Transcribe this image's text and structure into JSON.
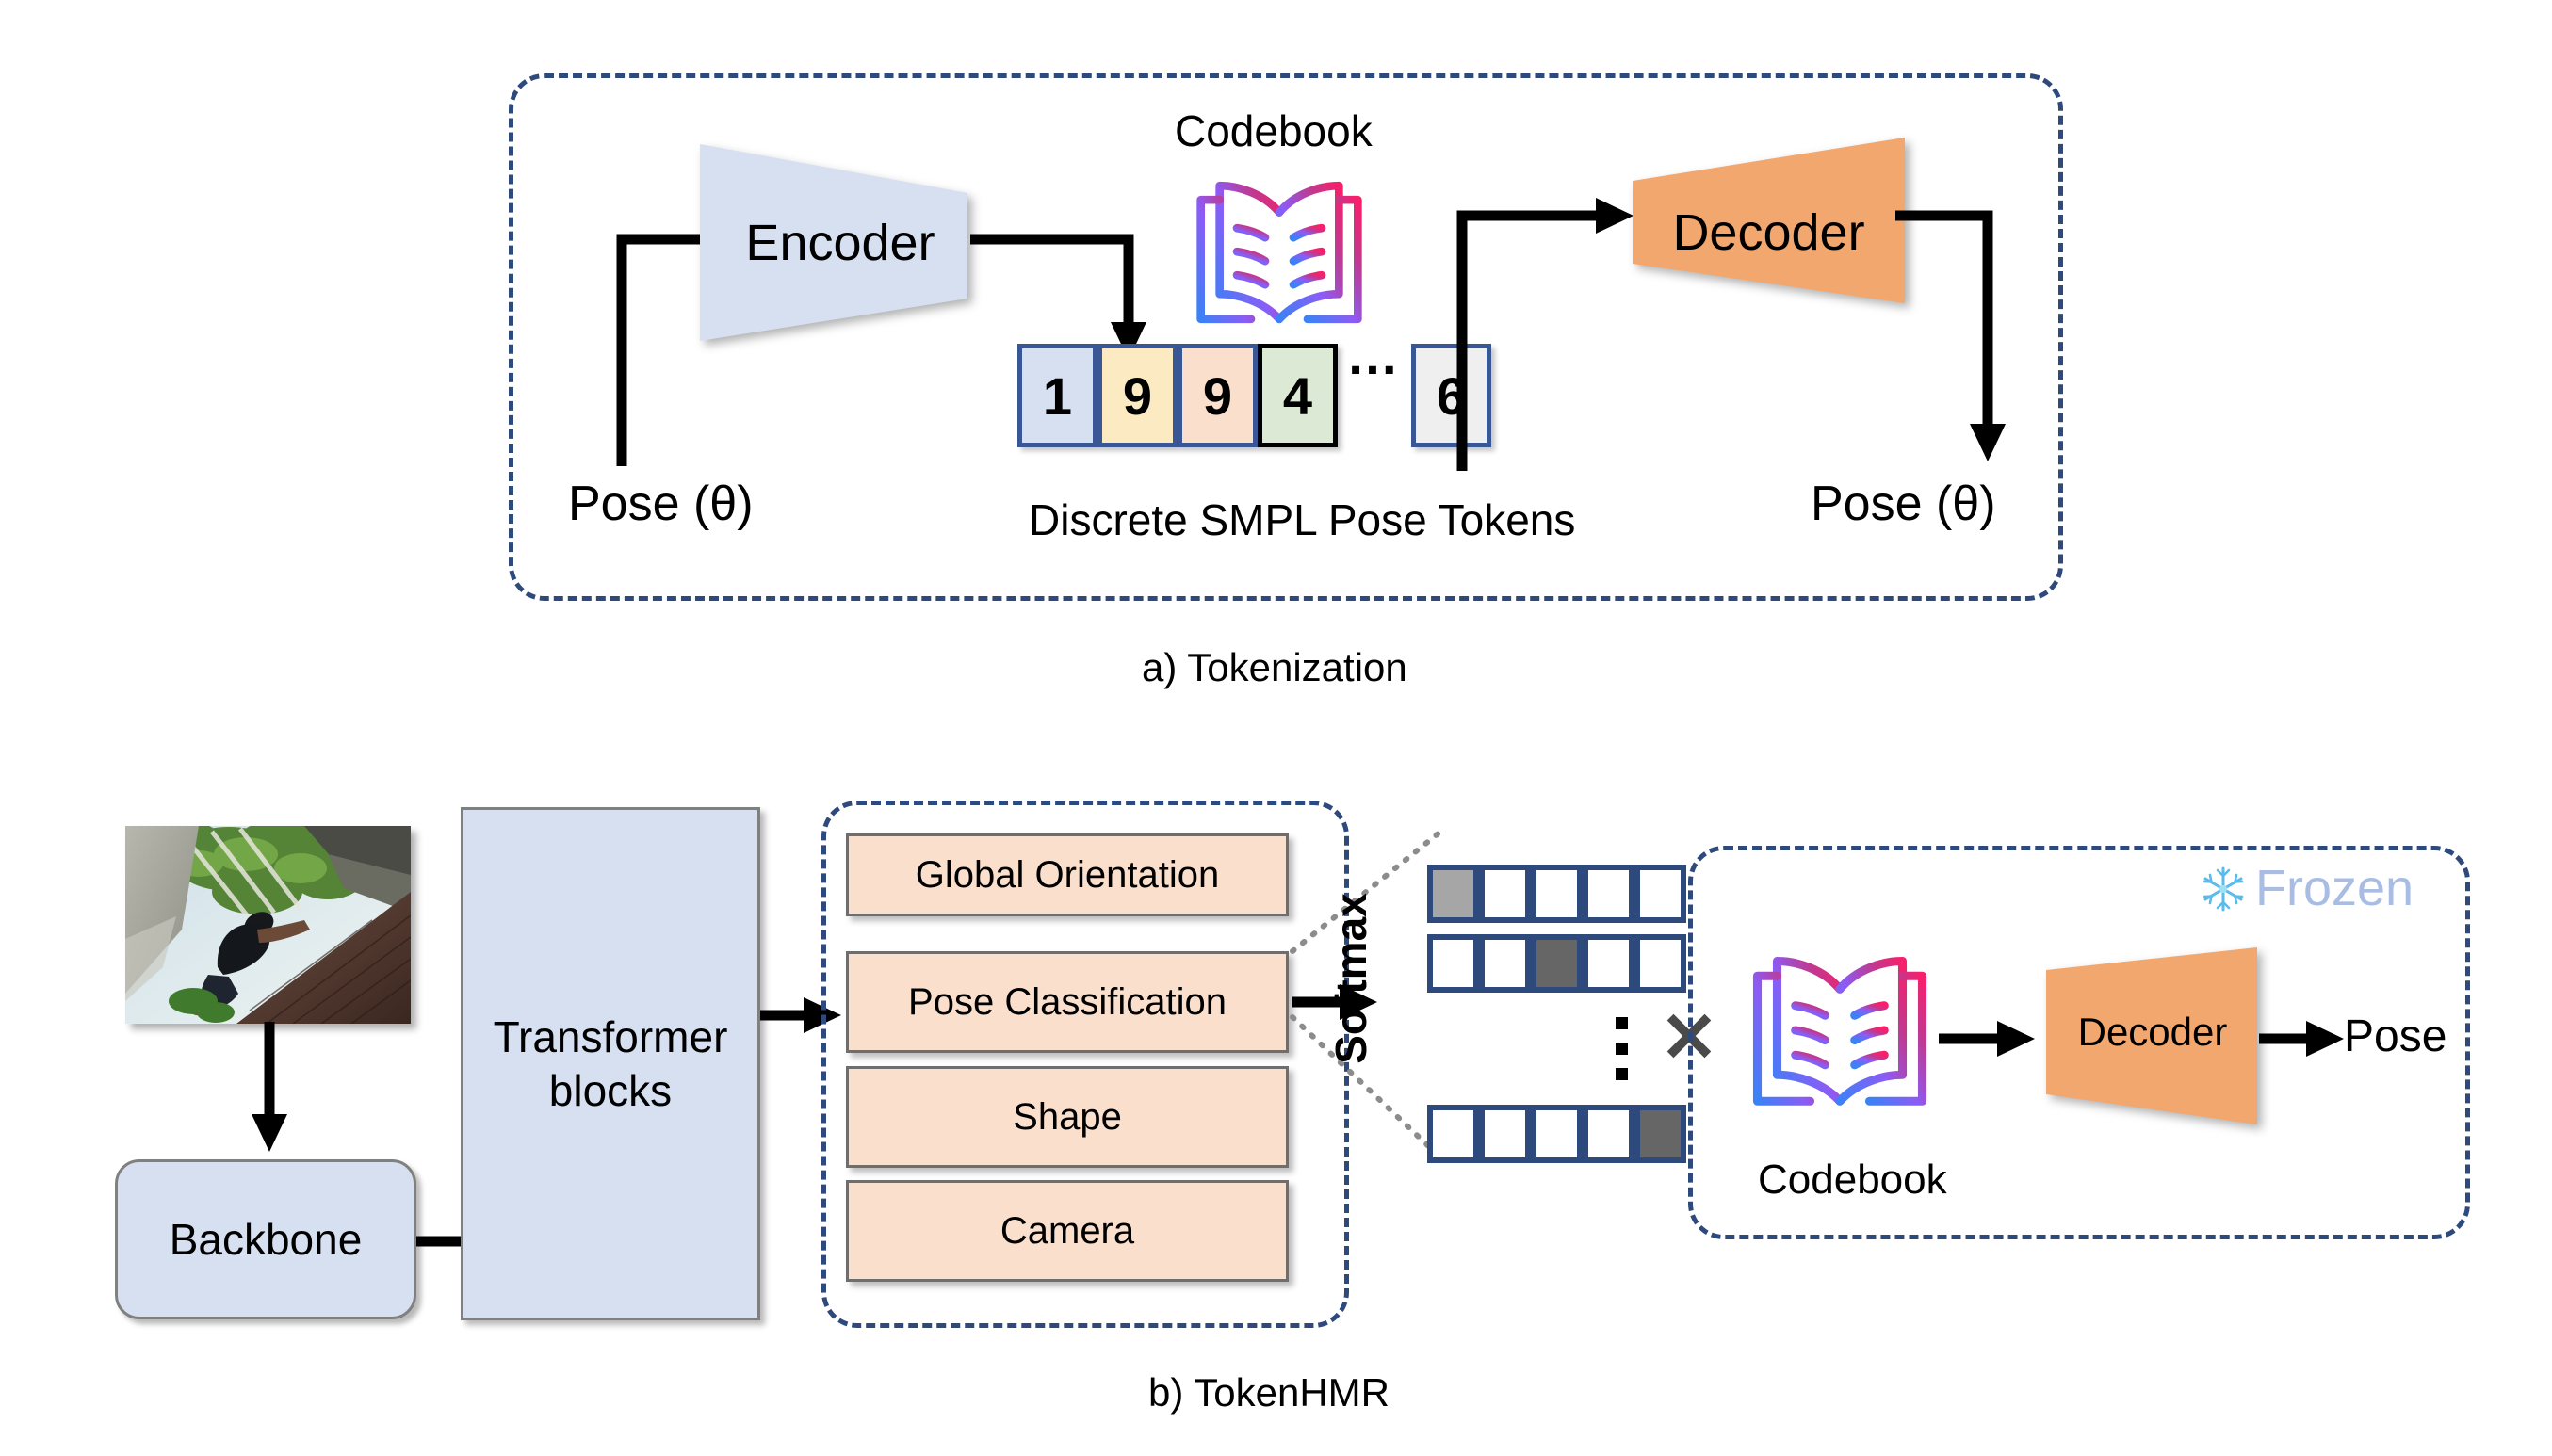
{
  "figure": {
    "panel_a": {
      "caption": "a) Tokenization",
      "encoder_label": "Encoder",
      "decoder_label": "Decoder",
      "codebook_label": "Codebook",
      "codebook_icon": "open-book-icon",
      "input_label": "Pose (θ)",
      "output_label": "Pose (θ)",
      "tokens_caption": "Discrete SMPL Pose Tokens",
      "tokens": [
        {
          "value": "1",
          "fill": "#D6E0F0",
          "border": "#3A5795"
        },
        {
          "value": "9",
          "fill": "#FCEBC2",
          "border": "#3A5795"
        },
        {
          "value": "9",
          "fill": "#FADFCD",
          "border": "#3A5795"
        },
        {
          "value": "4",
          "fill": "#DCEAD5",
          "border": "#000000"
        },
        {
          "value": "6",
          "fill": "#EFEFEF",
          "border": "#3A5795"
        }
      ],
      "tokens_ellipsis": "…"
    },
    "panel_b": {
      "caption": "b) TokenHMR",
      "input_image_alt": "person crouching on brick ledge under trees",
      "backbone_label": "Backbone",
      "transformer_label": "Transformer\nblocks",
      "transformer_line1": "Transformer",
      "transformer_line2": "blocks",
      "heads": [
        {
          "label": "Global Orientation"
        },
        {
          "label": "Pose Classification"
        },
        {
          "label": "Shape"
        },
        {
          "label": "Camera"
        }
      ],
      "softmax_label": "Softmax",
      "multiply_symbol": "✕",
      "prob_matrix": {
        "rows": 3,
        "cols": 5,
        "row_highlights": [
          {
            "index": 0,
            "fill": "#A6A6A6"
          },
          {
            "index": 2,
            "fill": "#666666"
          },
          {
            "index": 4,
            "fill": "#666666"
          }
        ],
        "ellipsis": "⋮"
      },
      "frozen_label": "Frozen",
      "frozen_icon": "snowflake-icon",
      "codebook_label": "Codebook",
      "codebook_icon": "open-book-icon",
      "decoder_label": "Decoder",
      "pose_output_label": "Pose"
    }
  },
  "colors": {
    "dashed_border": "#2E4A7D",
    "box_blue": "#D6E0F0",
    "box_peach": "#FADFCD",
    "decoder_orange": "#F2A76E",
    "frozen_text": "#A9BDE4",
    "grid_border": "#2E4A7D",
    "cell_light_gray": "#A6A6A6",
    "cell_dark_gray": "#666666",
    "multiply_gray": "#4A4A4A"
  }
}
